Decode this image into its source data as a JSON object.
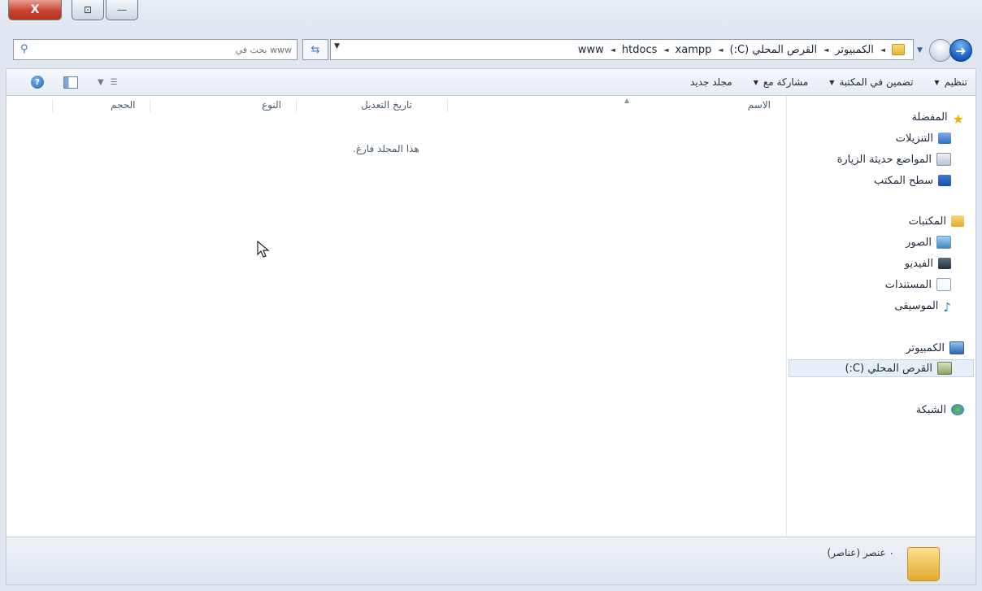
{
  "titlebar": {
    "close_glyph": "X",
    "maximize_glyph": "⊡",
    "minimize_glyph": "—"
  },
  "address": {
    "crumbs": [
      "www",
      "htdocs",
      "xampp",
      "القرص المحلي (C:)",
      "الكمبيوتر"
    ],
    "search_placeholder": "بحث في www"
  },
  "toolbar": {
    "organize": "تنظيم",
    "include_library": "تضمين في المكتبة",
    "share_with": "مشاركة مع",
    "new_folder": "مجلد جديد"
  },
  "navpane": {
    "favorites": "المفضلة",
    "downloads": "التنزيلات",
    "recent": "المواضع حديثة الزيارة",
    "desktop": "سطح المكتب",
    "libraries": "المكتبات",
    "pictures": "الصور",
    "videos": "الفيديو",
    "documents": "المستندات",
    "music": "الموسيقى",
    "computer": "الكمبيوتر",
    "local_disk": "القرص المحلي (C:)",
    "network": "الشبكة"
  },
  "columns": {
    "name": "الاسم",
    "date_modified": "تاريخ التعديل",
    "type": "النوع",
    "size": "الحجم"
  },
  "main": {
    "empty_message": "هذا المجلد فارغ."
  },
  "details": {
    "item_count": "٠ عنصر (عناصر)"
  },
  "colors": {
    "selected_bg": "#e6eef8",
    "accent": "#1e64c7"
  }
}
